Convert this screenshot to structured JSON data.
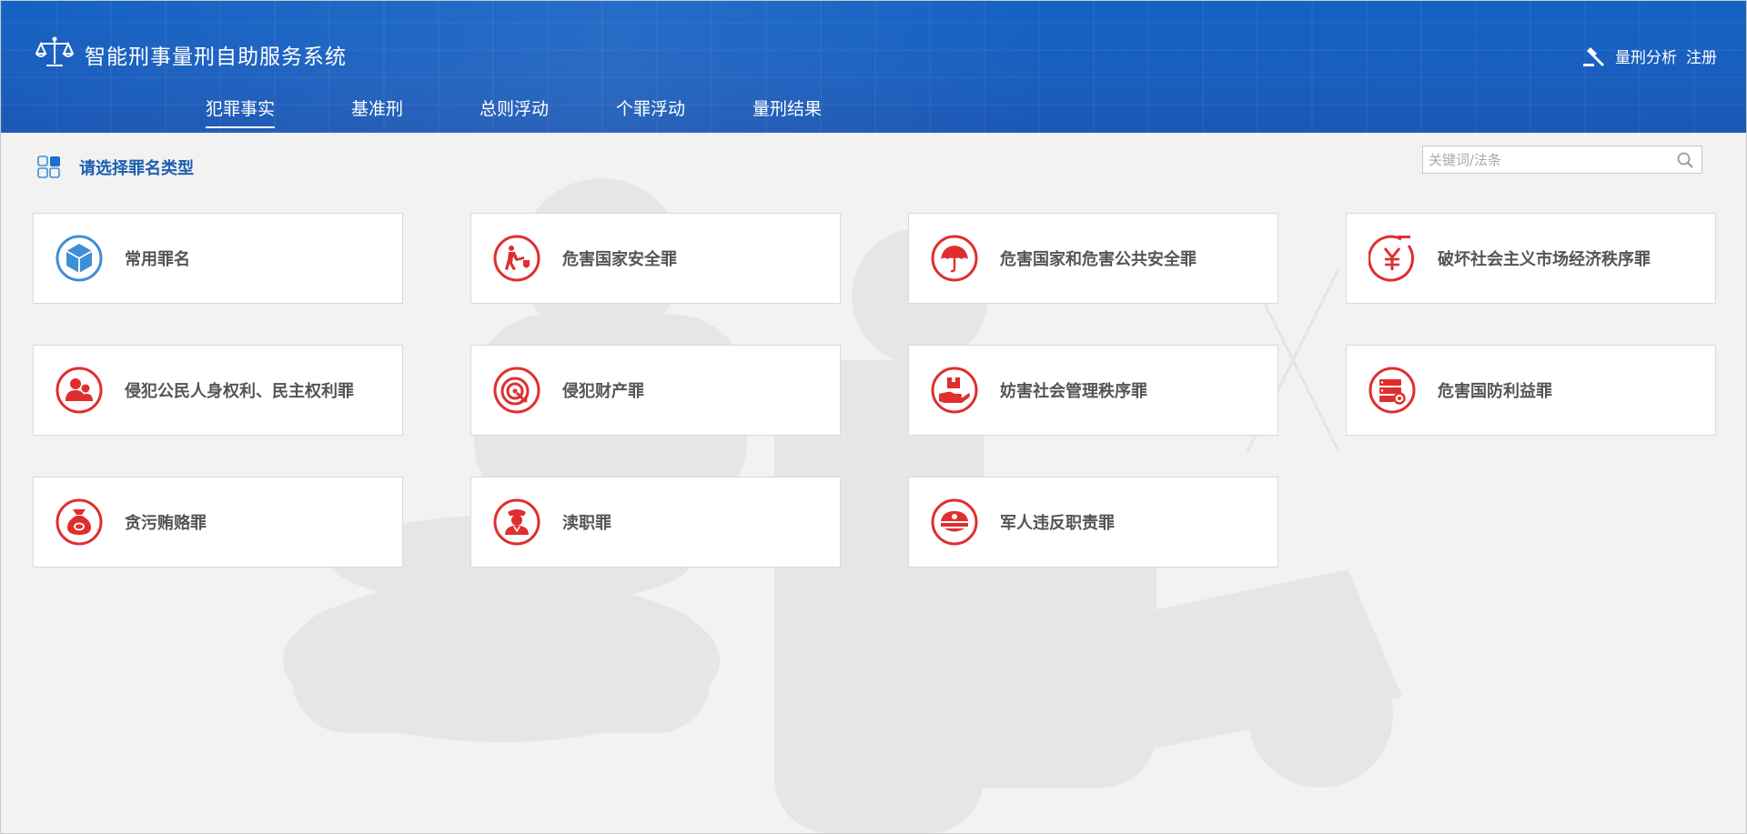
{
  "app": {
    "title": "智能刑事量刑自助服务系统"
  },
  "header_right": {
    "analysis_label": "量刑分析",
    "register_label": "注册"
  },
  "nav": {
    "tabs": [
      {
        "label": "犯罪事实",
        "active": true
      },
      {
        "label": "基准刑",
        "active": false
      },
      {
        "label": "总则浮动",
        "active": false
      },
      {
        "label": "个罪浮动",
        "active": false
      },
      {
        "label": "量刑结果",
        "active": false
      }
    ]
  },
  "section": {
    "title": "请选择罪名类型"
  },
  "search": {
    "placeholder": "关键词/法条",
    "value": ""
  },
  "categories": [
    {
      "label": "常用罪名",
      "icon": "cube-icon"
    },
    {
      "label": "危害国家安全罪",
      "icon": "soldier-shield-icon"
    },
    {
      "label": "危害国家和危害公共安全罪",
      "icon": "umbrella-icon"
    },
    {
      "label": "破坏社会主义市场经济秩序罪",
      "icon": "yuan-icon"
    },
    {
      "label": "侵犯公民人身权利、民主权利罪",
      "icon": "people-icon"
    },
    {
      "label": "侵犯财产罪",
      "icon": "target-icon"
    },
    {
      "label": "妨害社会管理秩序罪",
      "icon": "hand-box-icon"
    },
    {
      "label": "危害国防利益罪",
      "icon": "server-icon"
    },
    {
      "label": "贪污贿赂罪",
      "icon": "money-bag-icon"
    },
    {
      "label": "渎职罪",
      "icon": "officer-icon"
    },
    {
      "label": "军人违反职责罪",
      "icon": "military-cap-icon"
    }
  ],
  "colors": {
    "header_blue": "#1a5fbf",
    "accent_red": "#e02e2e",
    "accent_blue": "#3d8fd6",
    "section_blue": "#1d5fb0"
  }
}
